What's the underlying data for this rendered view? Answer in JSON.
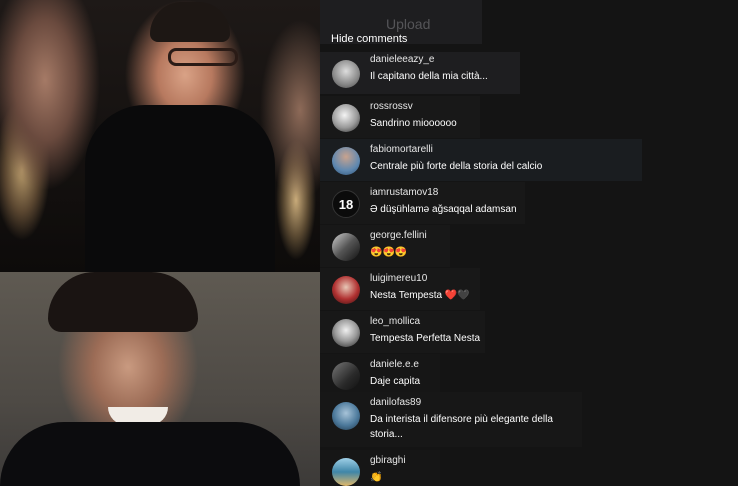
{
  "header": {
    "upload_label": "Upload",
    "hide_comments_label": "Hide comments"
  },
  "comments": [
    {
      "user": "danieleeazy_e",
      "text": "Il capitano della mia città..."
    },
    {
      "user": "rossrossv",
      "text": "Sandrino mioooooo"
    },
    {
      "user": "fabiomortarelli",
      "text": "Centrale più forte della storia del calcio"
    },
    {
      "user": "iamrustamov18",
      "text": "Ə düşühlamə ağsaqqal adamsan",
      "avatar_text": "18"
    },
    {
      "user": "george.fellini",
      "text": "😍😍😍"
    },
    {
      "user": "luigimereu10",
      "text": "Nesta Tempesta",
      "suffix": "❤️🖤"
    },
    {
      "user": "leo_mollica",
      "text": "Tempesta Perfetta Nesta"
    },
    {
      "user": "daniele.e.e",
      "text": "Daje capita"
    },
    {
      "user": "danilofas89",
      "text": "Da interista il difensore più elegante della storia..."
    },
    {
      "user": "gbiraghi",
      "text": "👏"
    }
  ],
  "colors": {
    "panel_bg": "#141414",
    "comment_bg": "#1e1e20",
    "accent_heart": "#e03030"
  }
}
